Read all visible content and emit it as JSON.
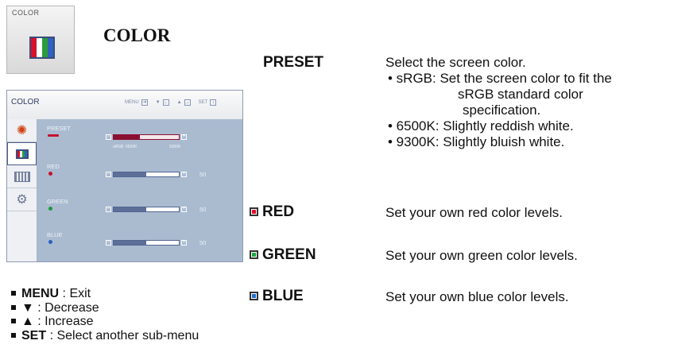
{
  "tile": {
    "label": "COLOR"
  },
  "page_title": "COLOR",
  "osd": {
    "title": "COLOR",
    "keys": {
      "menu": "MENU",
      "set": "SET"
    },
    "preset": {
      "label": "PRESET",
      "ticks": [
        "sRGB",
        "6500K",
        "9300K"
      ]
    },
    "rows": [
      {
        "label": "RED",
        "value": "50",
        "level": 50,
        "color": "#c8102e"
      },
      {
        "label": "GREEN",
        "value": "50",
        "level": 50,
        "color": "#1a9a3a"
      },
      {
        "label": "BLUE",
        "value": "50",
        "level": 50,
        "color": "#2a5fc0"
      }
    ]
  },
  "legend": [
    {
      "key": "MENU",
      "text": " : Exit"
    },
    {
      "key": "▼",
      "text": " : Decrease"
    },
    {
      "key": "▲",
      "text": " : Increase"
    },
    {
      "key": "SET",
      "text": " : Select another sub-menu"
    }
  ],
  "items": {
    "preset": {
      "term": "PRESET",
      "desc": "Select the screen color.",
      "bullets": [
        {
          "line1": "• sRGB: Set the screen color to fit the",
          "line2": "sRGB standard color",
          "line3": "specification."
        },
        {
          "line1": "• 6500K: Slightly reddish white."
        },
        {
          "line1": "• 9300K: Slightly bluish white."
        }
      ]
    },
    "red": {
      "term": "RED",
      "desc": "Set your own red color levels.",
      "color": "#e0102a"
    },
    "green": {
      "term": "GREEN",
      "desc": "Set your own green color levels.",
      "color": "#1aa83c"
    },
    "blue": {
      "term": "BLUE",
      "desc": "Set your own blue color levels.",
      "color": "#1f6fd0"
    }
  }
}
